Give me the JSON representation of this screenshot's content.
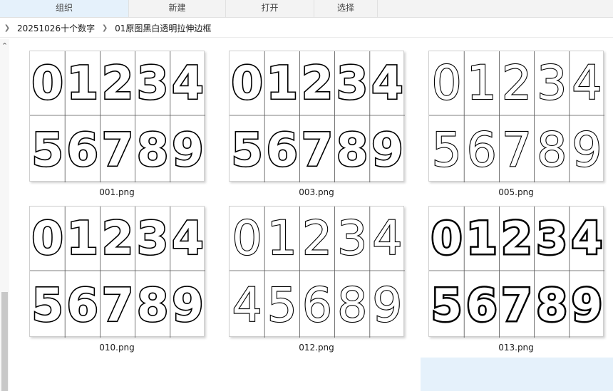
{
  "toolbar": {
    "items": [
      {
        "label": "组织"
      },
      {
        "label": "新建"
      },
      {
        "label": "打开"
      },
      {
        "label": "选择"
      }
    ]
  },
  "breadcrumb": {
    "items": [
      "20251026十个数字",
      "01原图黑白透明拉伸边框"
    ]
  },
  "files": [
    {
      "name": "001.png",
      "top_row": [
        "0",
        "1",
        "2",
        "3",
        "4"
      ],
      "bottom_row": [
        "5",
        "6",
        "7",
        "8",
        "9"
      ],
      "style": "regular"
    },
    {
      "name": "003.png",
      "top_row": [
        "0",
        "1",
        "2",
        "3",
        "4"
      ],
      "bottom_row": [
        "5",
        "6",
        "7",
        "8",
        "9"
      ],
      "style": "regular"
    },
    {
      "name": "005.png",
      "top_row": [
        "0",
        "1",
        "2",
        "3",
        "4"
      ],
      "bottom_row": [
        "5",
        "6",
        "7",
        "8",
        "9"
      ],
      "style": "thin"
    },
    {
      "name": "010.png",
      "top_row": [
        "0",
        "1",
        "2",
        "3",
        "4"
      ],
      "bottom_row": [
        "5",
        "6",
        "7",
        "8",
        "9"
      ],
      "style": "regular"
    },
    {
      "name": "012.png",
      "top_row": [
        "0",
        "1",
        "2",
        "3",
        "4"
      ],
      "bottom_row": [
        "4",
        "5",
        "6",
        "8",
        "9"
      ],
      "style": "thin"
    },
    {
      "name": "013.png",
      "top_row": [
        "0",
        "1",
        "2",
        "3",
        "4"
      ],
      "bottom_row": [
        "5",
        "6",
        "7",
        "8",
        "9"
      ],
      "style": "bold"
    }
  ]
}
